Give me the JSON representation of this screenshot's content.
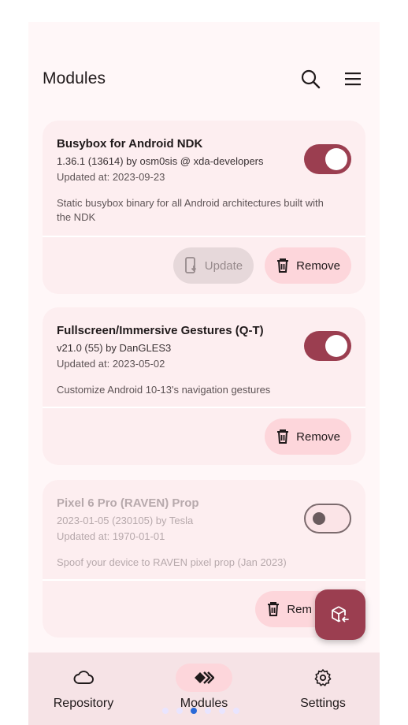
{
  "header": {
    "title": "Modules",
    "search_icon": "search-icon",
    "menu_icon": "menu-icon"
  },
  "modules": [
    {
      "name": "Busybox for Android NDK",
      "version": "1.36.1 (13614) by osm0sis @ xda-developers",
      "updated": "Updated at: 2023-09-23",
      "description": "Static busybox binary for all Android architectures built with the NDK",
      "enabled": true,
      "update_label": "Update",
      "remove_label": "Remove"
    },
    {
      "name": "Fullscreen/Immersive Gestures (Q-T)",
      "version": "v21.0 (55) by DanGLES3",
      "updated": "Updated at: 2023-05-02",
      "description": "Customize Android 10-13's navigation gestures",
      "enabled": true,
      "remove_label": "Remove"
    },
    {
      "name": "Pixel 6 Pro (RAVEN) Prop",
      "version": "2023-01-05 (230105) by Tesla",
      "updated": "Updated at: 1970-01-01",
      "description": "Spoof your device to RAVEN pixel prop (Jan 2023)",
      "enabled": false,
      "remove_label": "Rem"
    }
  ],
  "fab": {
    "icon": "install-module-icon"
  },
  "navbar": {
    "items": [
      {
        "label": "Repository",
        "icon": "cloud-icon",
        "active": false
      },
      {
        "label": "Modules",
        "icon": "modules-icon",
        "active": true
      },
      {
        "label": "Settings",
        "icon": "gear-icon",
        "active": false
      }
    ]
  },
  "page_indicator": {
    "count": 6,
    "active_index": 2
  },
  "colors": {
    "accent": "#9b3e50",
    "card": "#fdeef0",
    "tonal": "#fdd6db",
    "background": "#fff7f8"
  }
}
